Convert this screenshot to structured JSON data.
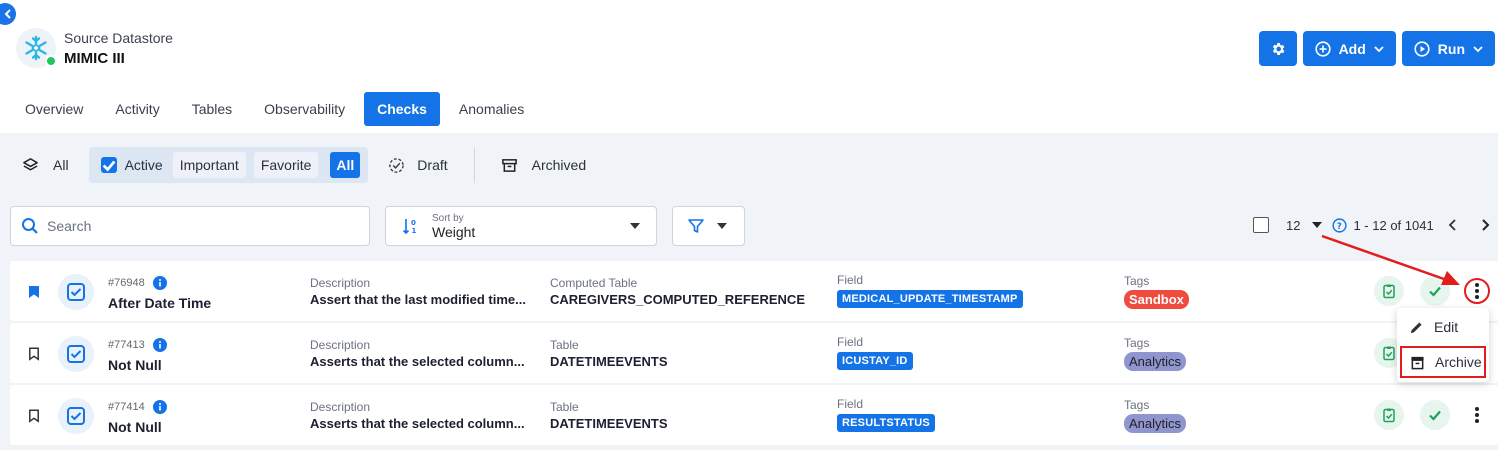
{
  "datastore": {
    "subtitle": "Source Datastore",
    "title": "MIMIC III",
    "status_color": "#22c55e"
  },
  "header_actions": {
    "settings_icon": "gear-icon",
    "add_label": "Add",
    "run_label": "Run"
  },
  "tabs": [
    {
      "label": "Overview"
    },
    {
      "label": "Activity"
    },
    {
      "label": "Tables"
    },
    {
      "label": "Observability"
    },
    {
      "label": "Checks",
      "active": true
    },
    {
      "label": "Anomalies"
    }
  ],
  "filters": {
    "all_label": "All",
    "active_label": "Active",
    "important_label": "Important",
    "favorite_label": "Favorite",
    "active_all_label": "All",
    "draft_label": "Draft",
    "archived_label": "Archived"
  },
  "search": {
    "placeholder": "Search"
  },
  "sort": {
    "label": "Sort by",
    "value": "Weight"
  },
  "pager": {
    "page_size": "12",
    "range": "1 - 12 of 1041"
  },
  "rows": [
    {
      "id": "#76948",
      "name": "After Date Time",
      "desc_label": "Description",
      "description": "Assert that the last modified time...",
      "table_label": "Computed Table",
      "table": "CAREGIVERS_COMPUTED_REFERENCE",
      "field_label": "Field",
      "field": "MEDICAL_UPDATE_TIMESTAMP",
      "tags_label": "Tags",
      "tag": "Sandbox",
      "bookmarked": true
    },
    {
      "id": "#77413",
      "name": "Not Null",
      "desc_label": "Description",
      "description": "Asserts that the selected column...",
      "table_label": "Table",
      "table": "DATETIMEEVENTS",
      "field_label": "Field",
      "field": "ICUSTAY_ID",
      "tags_label": "Tags",
      "tag": "Analytics",
      "bookmarked": false
    },
    {
      "id": "#77414",
      "name": "Not Null",
      "desc_label": "Description",
      "description": "Asserts that the selected column...",
      "table_label": "Table",
      "table": "DATETIMEEVENTS",
      "field_label": "Field",
      "field": "RESULTSTATUS",
      "tags_label": "Tags",
      "tag": "Analytics",
      "bookmarked": false
    }
  ],
  "context_menu": {
    "edit_label": "Edit",
    "archive_label": "Archive"
  },
  "colors": {
    "primary": "#1473e6",
    "annotation": "#e11d1d",
    "sandbox": "#ef4b3f",
    "analytics": "#8e95cf"
  }
}
